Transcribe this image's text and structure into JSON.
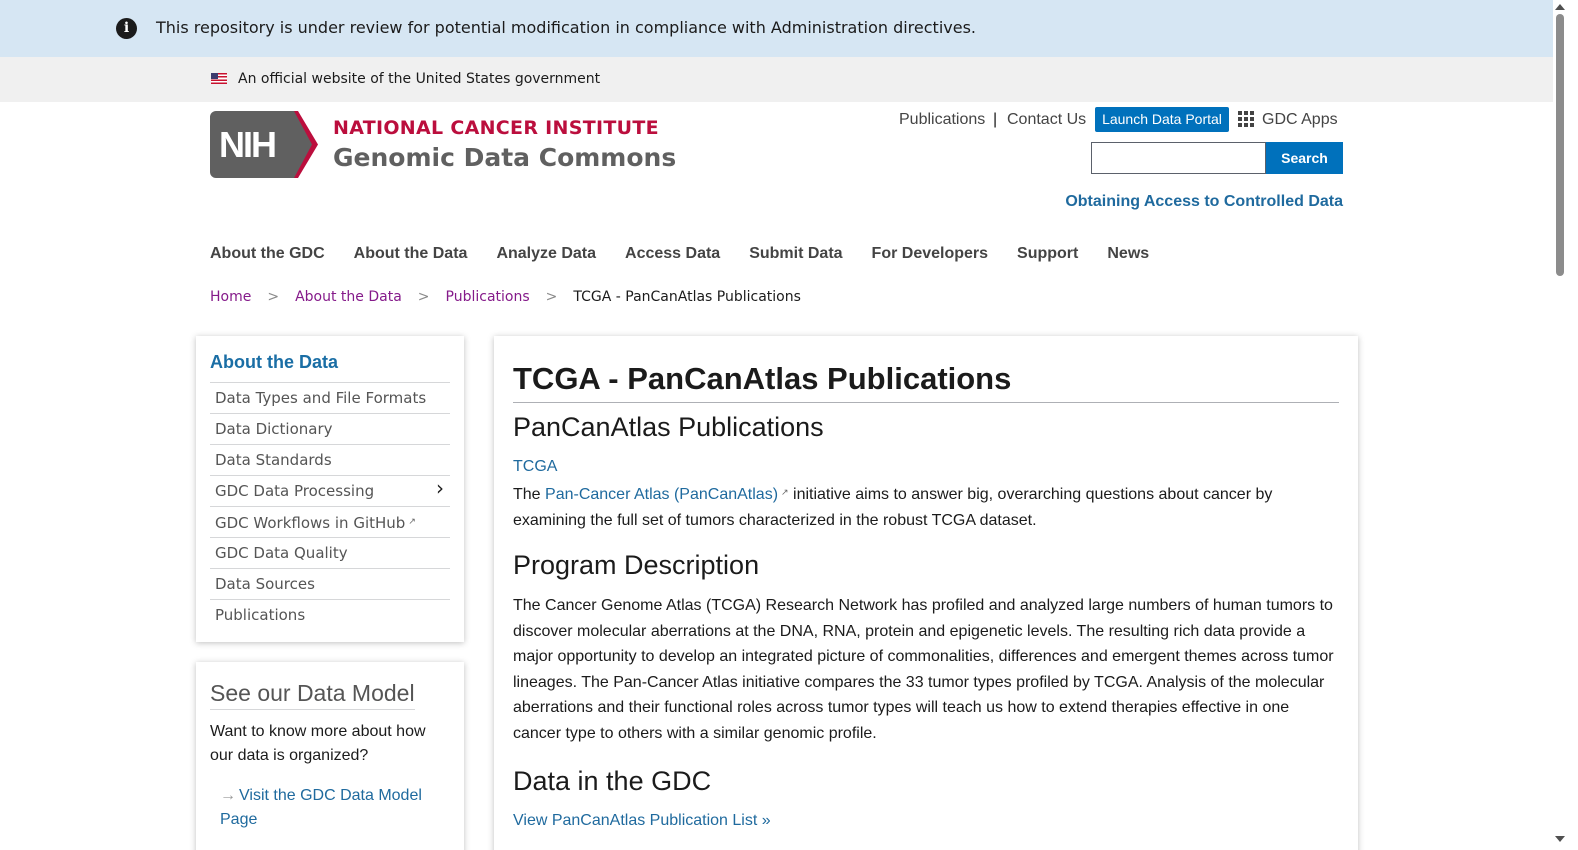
{
  "review_banner": {
    "message": "This repository is under review for potential modification in compliance with Administration directives."
  },
  "gov_banner": {
    "text": "An official website of the United States government"
  },
  "logo": {
    "nih": "NIH",
    "title": "NATIONAL CANCER INSTITUTE",
    "subtitle": "Genomic Data Commons"
  },
  "utility_nav": {
    "publications": "Publications",
    "separator": "|",
    "contact": "Contact Us",
    "launch": "Launch Data Portal",
    "apps": "GDC Apps"
  },
  "search": {
    "button": "Search",
    "value": ""
  },
  "controlled_access_link": "Obtaining Access to Controlled Data",
  "main_nav": [
    "About the GDC",
    "About the Data",
    "Analyze Data",
    "Access Data",
    "Submit Data",
    "For Developers",
    "Support",
    "News"
  ],
  "breadcrumb": {
    "home": "Home",
    "about": "About the Data",
    "publications": "Publications",
    "current": "TCGA - PanCanAtlas Publications",
    "sep": ">"
  },
  "sidebar": {
    "title": "About the Data",
    "items": [
      "Data Types and File Formats",
      "Data Dictionary",
      "Data Standards",
      "GDC Data Processing",
      "GDC Workflows in GitHub",
      "GDC Data Quality",
      "Data Sources",
      "Publications"
    ],
    "chevron": "›",
    "external_mark": "↗"
  },
  "data_model": {
    "title": "See our Data Model",
    "text": "Want to know more about how our data is organized?",
    "arrow": "→",
    "link": "Visit the GDC Data Model Page"
  },
  "content": {
    "title": "TCGA - PanCanAtlas Publications",
    "section1": "PanCanAtlas Publications",
    "tcga_link": "TCGA",
    "intro_pre": "The ",
    "intro_link": "Pan-Cancer Atlas (PanCanAtlas)",
    "intro_post": " initiative aims to answer big, overarching questions about cancer by examining the full set of tumors characterized in the robust TCGA dataset.",
    "section2": "Program Description",
    "description": "The Cancer Genome Atlas (TCGA) Research Network has profiled and analyzed large numbers of human tumors to discover molecular aberrations at the DNA, RNA, protein and epigenetic levels. The resulting rich data provide a major opportunity to develop an integrated picture of commonalities, differences and emergent themes across tumor lineages. The Pan-Cancer Atlas initiative compares the 33 tumor types profiled by TCGA. Analysis of the molecular aberrations and their functional roles across tumor types will teach us how to extend therapies effective in one cancer type to others with a similar genomic profile.",
    "section3": "Data in the GDC",
    "list_link": "View PanCanAtlas Publication List »"
  }
}
